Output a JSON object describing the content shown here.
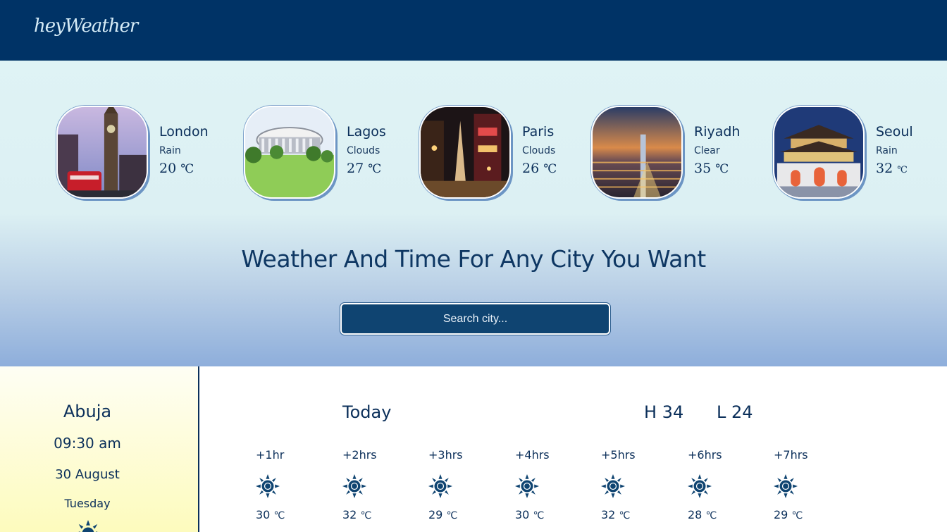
{
  "header": {
    "logo": "heyWeather"
  },
  "cities": [
    {
      "name": "London",
      "condition": "Rain",
      "temp": "20",
      "unit": "℃"
    },
    {
      "name": "Lagos",
      "condition": "Clouds",
      "temp": "27",
      "unit": "℃"
    },
    {
      "name": "Paris",
      "condition": "Clouds",
      "temp": "26",
      "unit": "℃"
    },
    {
      "name": "Riyadh",
      "condition": "Clear",
      "temp": "35",
      "unit": "℃"
    },
    {
      "name": "Seoul",
      "condition": "Rain",
      "temp": "32",
      "unit": "℃"
    }
  ],
  "hero": {
    "headline": "Weather And Time For Any City You Want",
    "search_placeholder": "Search city..."
  },
  "current": {
    "city": "Abuja",
    "time": "09:30 am",
    "date": "30 August",
    "day": "Tuesday",
    "icon": "sun-icon"
  },
  "forecast": {
    "label": "Today",
    "high": "H 34",
    "low": "L 24",
    "hours": [
      {
        "label": "+1hr",
        "temp": "30",
        "unit": "℃",
        "icon": "sun-icon"
      },
      {
        "label": "+2hrs",
        "temp": "32",
        "unit": "℃",
        "icon": "sun-icon"
      },
      {
        "label": "+3hrs",
        "temp": "29",
        "unit": "℃",
        "icon": "sun-icon"
      },
      {
        "label": "+4hrs",
        "temp": "30",
        "unit": "℃",
        "icon": "sun-icon"
      },
      {
        "label": "+5hrs",
        "temp": "32",
        "unit": "℃",
        "icon": "sun-icon"
      },
      {
        "label": "+6hrs",
        "temp": "28",
        "unit": "℃",
        "icon": "sun-icon"
      },
      {
        "label": "+7hrs",
        "temp": "29",
        "unit": "℃",
        "icon": "sun-icon"
      }
    ]
  },
  "colors": {
    "primary": "#003366",
    "accent": "#0f4471",
    "text": "#0b2f5a"
  }
}
